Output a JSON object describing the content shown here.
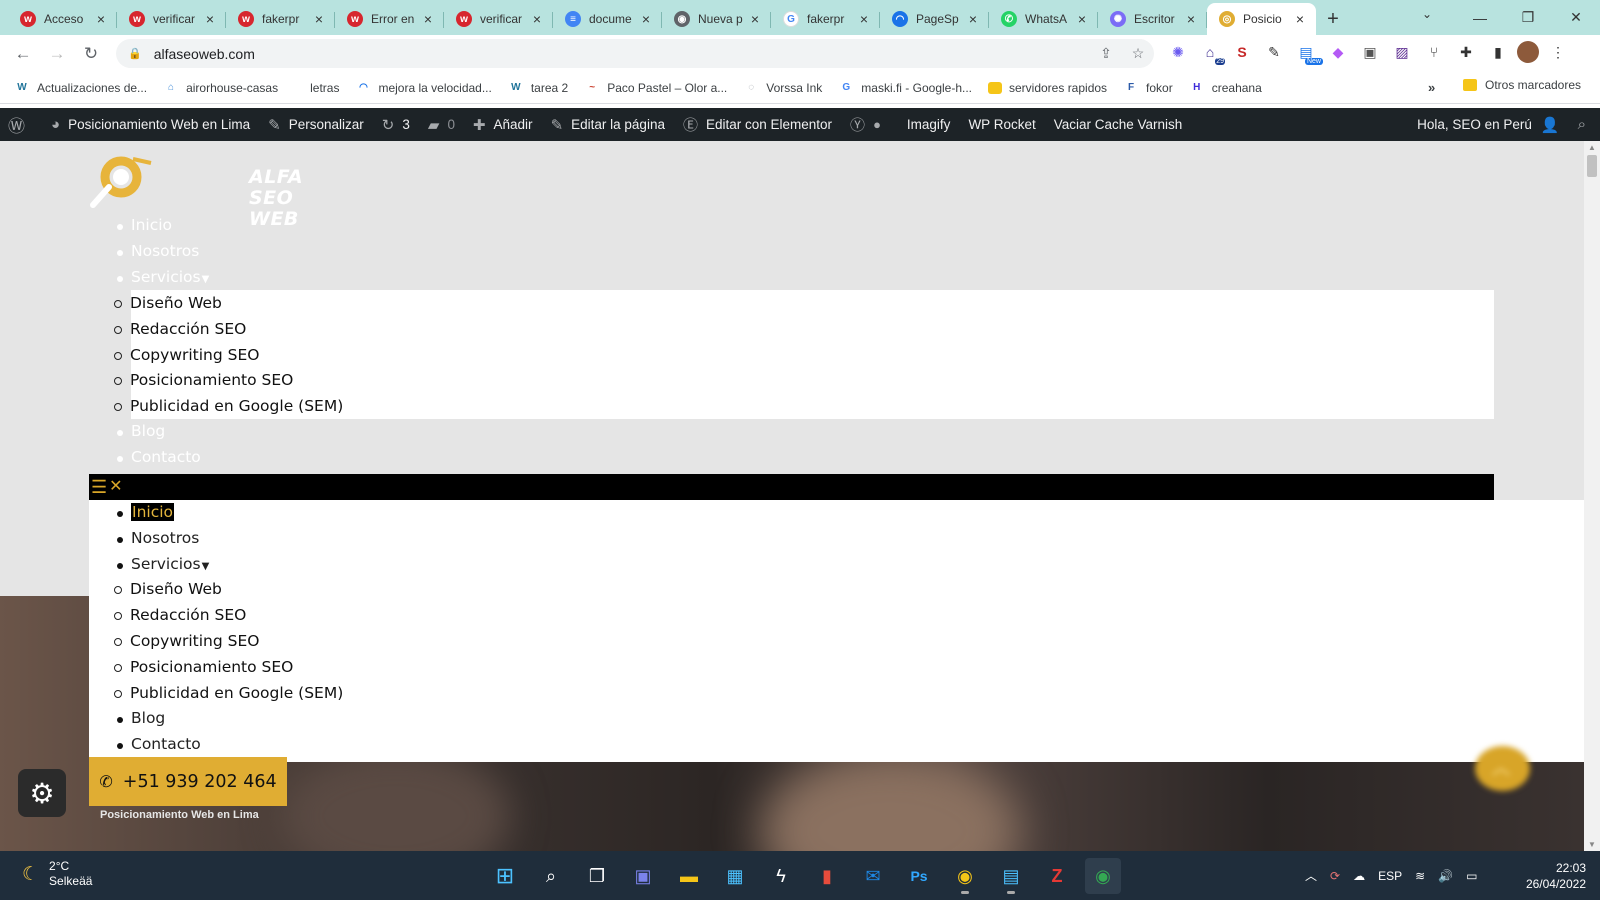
{
  "browser": {
    "tabs": [
      {
        "title": "Acceso",
        "icon": "wp-engine-icon",
        "color": "#d7262e",
        "glyph": "w"
      },
      {
        "title": "verificar",
        "icon": "wp-engine-icon",
        "color": "#d7262e",
        "glyph": "w"
      },
      {
        "title": "fakerpr",
        "icon": "wp-engine-icon",
        "color": "#d7262e",
        "glyph": "w"
      },
      {
        "title": "Error en",
        "icon": "wp-engine-icon",
        "color": "#d7262e",
        "glyph": "w"
      },
      {
        "title": "verificar",
        "icon": "wp-engine-icon",
        "color": "#d7262e",
        "glyph": "w"
      },
      {
        "title": "docume",
        "icon": "google-docs-icon",
        "color": "#4285f4",
        "glyph": "≡"
      },
      {
        "title": "Nueva p",
        "icon": "chrome-icon",
        "color": "#5f6368",
        "glyph": "◉"
      },
      {
        "title": "fakerpr",
        "icon": "google-icon",
        "color": "#ffffff",
        "glyph": "G"
      },
      {
        "title": "PageSp",
        "icon": "pagespeed-icon",
        "color": "#1a73e8",
        "glyph": "◠"
      },
      {
        "title": "WhatsA",
        "icon": "whatsapp-icon",
        "color": "#25d366",
        "glyph": "✆"
      },
      {
        "title": "Escritor",
        "icon": "perplexity-icon",
        "color": "#7b6cf6",
        "glyph": "✺"
      },
      {
        "title": "Posicio",
        "icon": "alfaseoweb-icon",
        "color": "#e0ad33",
        "glyph": "◎"
      }
    ],
    "url": "alfaseoweb.com",
    "bookmarks": [
      {
        "label": "Actualizaciones de...",
        "icon": "wordpress-icon",
        "color": "#21759b",
        "glyph": "W"
      },
      {
        "label": "airorhouse-casas",
        "icon": "airorhouse-icon",
        "color": "#4a90d9",
        "glyph": "⌂"
      },
      {
        "label": "letras",
        "icon": "",
        "color": "#ffffff",
        "glyph": ""
      },
      {
        "label": "mejora la velocidad...",
        "icon": "pagespeed-icon",
        "color": "#1a73e8",
        "glyph": "◠"
      },
      {
        "label": "tarea 2",
        "icon": "wordpress-icon",
        "color": "#21759b",
        "glyph": "W"
      },
      {
        "label": "Paco Pastel – Olor a...",
        "icon": "pacopastel-icon",
        "color": "#c43",
        "glyph": "~"
      },
      {
        "label": "Vorssa Ink",
        "icon": "globe-icon",
        "color": "#9aa0a6",
        "glyph": "◌"
      },
      {
        "label": "maski.fi - Google-h...",
        "icon": "google-icon",
        "color": "#ffffff",
        "glyph": "G"
      },
      {
        "label": "servidores rapidos",
        "icon": "folder-icon",
        "color": "#f5c518",
        "glyph": ""
      },
      {
        "label": "fokor",
        "icon": "fokor-icon",
        "color": "#2b5aa8",
        "glyph": "F"
      },
      {
        "label": "creahana",
        "icon": "crehana-icon",
        "color": "#3f2cd9",
        "glyph": "H"
      }
    ],
    "bookmarks_more": "»",
    "other_bookmarks": "Otros marcadores",
    "extension_badge_29": "29",
    "extension_badge_new": "New"
  },
  "adminbar": {
    "site_name": "Posicionamiento Web en Lima",
    "customize": "Personalizar",
    "updates_count": "3",
    "comments_count": "0",
    "add_new": "Añadir",
    "edit_page": "Editar la página",
    "edit_elementor": "Editar con Elementor",
    "imagify": "Imagify",
    "wp_rocket": "WP Rocket",
    "varnish": "Vaciar Cache Varnish",
    "greeting": "Hola, SEO en Perú"
  },
  "site": {
    "logo_line1": "ALFA",
    "logo_line2": "SEO WEB",
    "menu": {
      "inicio": "Inicio",
      "nosotros": "Nosotros",
      "servicios": "Servicios",
      "blog": "Blog",
      "contacto": "Contacto",
      "services": [
        "Diseño Web",
        "Redacción SEO",
        "Copywriting SEO",
        "Posicionamiento SEO",
        "Publicidad en Google (SEM)"
      ]
    },
    "phone": "+51 939 202 464",
    "footer_caption": "Posicionamiento Web en Lima",
    "accent": "#e0ad33"
  },
  "taskbar": {
    "temperature": "2°C",
    "weather": "Selkeää",
    "language": "ESP",
    "time": "22:03",
    "date": "26/04/2022"
  }
}
